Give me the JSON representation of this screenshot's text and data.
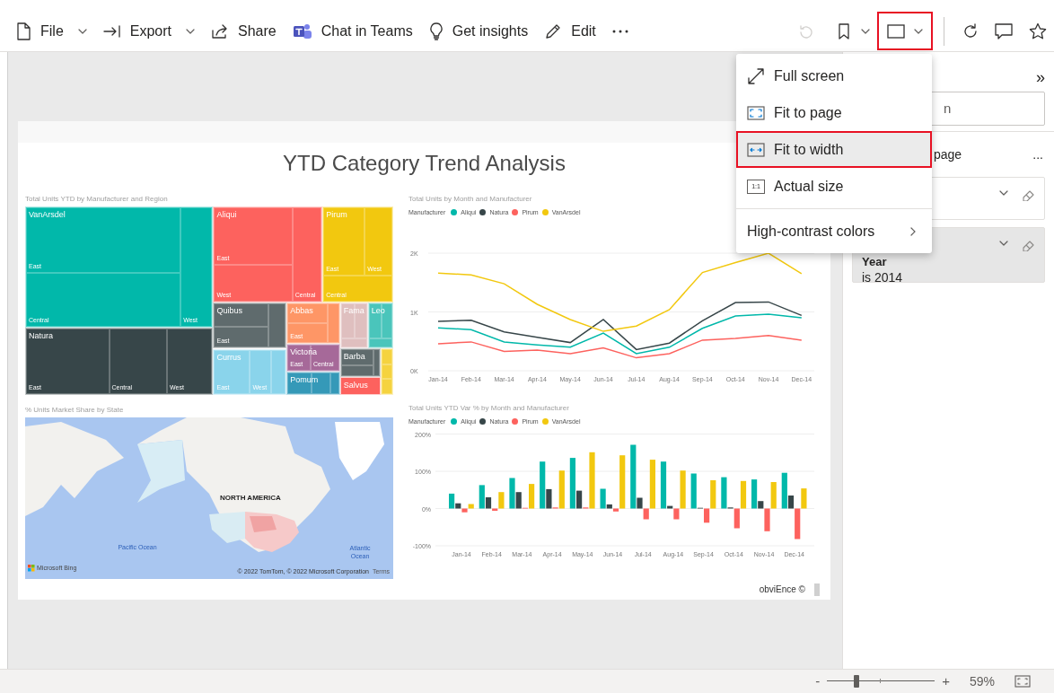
{
  "toolbar": {
    "items": [
      {
        "label": "File",
        "dropdown": true
      },
      {
        "label": "Export",
        "dropdown": true
      },
      {
        "label": "Share",
        "dropdown": false
      },
      {
        "label": "Chat in Teams",
        "dropdown": false
      },
      {
        "label": "Get insights",
        "dropdown": false
      },
      {
        "label": "Edit",
        "dropdown": false
      }
    ],
    "reset_disabled": true,
    "view_highlighted": true
  },
  "view_menu": {
    "items": [
      {
        "label": "Full screen",
        "selected": false,
        "highlighted": false,
        "submenu": false
      },
      {
        "label": "Fit to page",
        "selected": false,
        "highlighted": false,
        "submenu": false
      },
      {
        "label": "Fit to width",
        "selected": true,
        "highlighted": true,
        "submenu": false
      },
      {
        "label": "Actual size",
        "badge": "1:1",
        "selected": false,
        "highlighted": false,
        "submenu": false
      },
      {
        "label": "High-contrast colors",
        "selected": false,
        "highlighted": false,
        "submenu": true
      }
    ]
  },
  "filters_pane": {
    "collapse": "»",
    "search_value": "n",
    "section_label": "page",
    "more": "...",
    "filters": [
      {
        "selected": false
      },
      {
        "name": "Year",
        "condition": "is 2014",
        "selected": true
      }
    ]
  },
  "report": {
    "title": "YTD Category Trend Analysis",
    "footer": "obviEnce ©",
    "treemap": {
      "title": "Total Units YTD by Manufacturer and Region",
      "tiles": [
        {
          "name": "VanArsdel",
          "color": "#01b8aa",
          "regions": [
            "East",
            "Central",
            "West"
          ]
        },
        {
          "name": "Natura",
          "color": "#374649",
          "regions": [
            "East",
            "Central",
            "West"
          ]
        },
        {
          "name": "Aliqui",
          "color": "#fd625e",
          "regions": [
            "East",
            "West",
            "Central"
          ]
        },
        {
          "name": "Pirum",
          "color": "#f2c80f",
          "regions": [
            "East",
            "West",
            "Central"
          ]
        },
        {
          "name": "Quibus",
          "color": "#5f6b6d",
          "regions": [
            "East"
          ]
        },
        {
          "name": "Currus",
          "color": "#8ad4eb",
          "regions": [
            "East",
            "West"
          ]
        },
        {
          "name": "Abbas",
          "color": "#fe9666",
          "regions": [
            "East"
          ]
        },
        {
          "name": "Victoria",
          "color": "#a66999",
          "regions": [
            "East",
            "Central"
          ]
        },
        {
          "name": "Pomum",
          "color": "#3599b8"
        },
        {
          "name": "Fama",
          "color": "#dfbfbf"
        },
        {
          "name": "Leo",
          "color": "#4ac5bb"
        },
        {
          "name": "Barba",
          "color": "#5f6b6d"
        },
        {
          "name": "Salvus",
          "color": "#fd625e"
        },
        {
          "color": "#f5d33f"
        }
      ]
    },
    "line_chart": {
      "title": "Total Units by Month and Manufacturer",
      "legend_title": "Manufacturer",
      "chart_data": {
        "type": "line",
        "categories": [
          "Jan-14",
          "Feb-14",
          "Mar-14",
          "Apr-14",
          "May-14",
          "Jun-14",
          "Jul-14",
          "Aug-14",
          "Sep-14",
          "Oct-14",
          "Nov-14",
          "Dec-14"
        ],
        "ylim": [
          0,
          2000
        ],
        "yticks": [
          {
            "value": 0,
            "label": "0K"
          },
          {
            "value": 1000,
            "label": "1K"
          },
          {
            "value": 2000,
            "label": "2K"
          }
        ],
        "series": [
          {
            "name": "Aliqui",
            "color": "#01b8aa",
            "values": [
              730,
              700,
              490,
              440,
              400,
              640,
              290,
              400,
              720,
              930,
              960,
              900
            ]
          },
          {
            "name": "Natura",
            "color": "#374649",
            "values": [
              840,
              860,
              660,
              570,
              480,
              870,
              360,
              470,
              850,
              1160,
              1170,
              940
            ]
          },
          {
            "name": "Pirum",
            "color": "#fd625e",
            "values": [
              460,
              490,
              330,
              350,
              290,
              390,
              220,
              290,
              520,
              550,
              600,
              520
            ]
          },
          {
            "name": "VanArsdel",
            "color": "#f2c80f",
            "values": [
              1660,
              1630,
              1480,
              1130,
              870,
              670,
              760,
              1040,
              1670,
              1840,
              2000,
              1650
            ]
          }
        ]
      }
    },
    "map": {
      "title": "% Units Market Share by State",
      "region_label": "NORTH AMERICA",
      "ocean_labels": [
        "Pacific Ocean",
        "Atlantic Ocean"
      ],
      "provider": "Microsoft Bing",
      "copyright": "© 2022 TomTom, © 2022 Microsoft Corporation",
      "terms": "Terms"
    },
    "bar_chart": {
      "title": "Total Units YTD Var % by Month and Manufacturer",
      "legend_title": "Manufacturer",
      "chart_data": {
        "type": "bar",
        "categories": [
          "Jan-14",
          "Feb-14",
          "Mar-14",
          "Apr-14",
          "May-14",
          "Jun-14",
          "Jul-14",
          "Aug-14",
          "Sep-14",
          "Oct-14",
          "Nov-14",
          "Dec-14"
        ],
        "ylim": [
          -100,
          200
        ],
        "yticks": [
          {
            "value": -100,
            "label": "-100%"
          },
          {
            "value": 0,
            "label": "0%"
          },
          {
            "value": 100,
            "label": "100%"
          },
          {
            "value": 200,
            "label": "200%"
          }
        ],
        "series": [
          {
            "name": "Aliqui",
            "color": "#01b8aa",
            "values": [
              40,
              63,
              82,
              126,
              136,
              53,
              171,
              126,
              94,
              84,
              78,
              96
            ]
          },
          {
            "name": "Natura",
            "color": "#374649",
            "values": [
              14,
              30,
              44,
              52,
              48,
              11,
              29,
              7,
              2,
              3,
              20,
              35
            ]
          },
          {
            "name": "Pirum",
            "color": "#fd625e",
            "values": [
              -10,
              -6,
              2,
              3,
              3,
              -8,
              -29,
              -29,
              -38,
              -53,
              -61,
              -82
            ]
          },
          {
            "name": "VanArsdel",
            "color": "#f2c80f",
            "values": [
              12,
              44,
              66,
              102,
              151,
              143,
              131,
              102,
              76,
              74,
              71,
              54
            ]
          }
        ]
      }
    }
  },
  "status_bar": {
    "zoom_out": "-",
    "zoom_in": "+",
    "zoom": "59%",
    "level": 0.27
  }
}
